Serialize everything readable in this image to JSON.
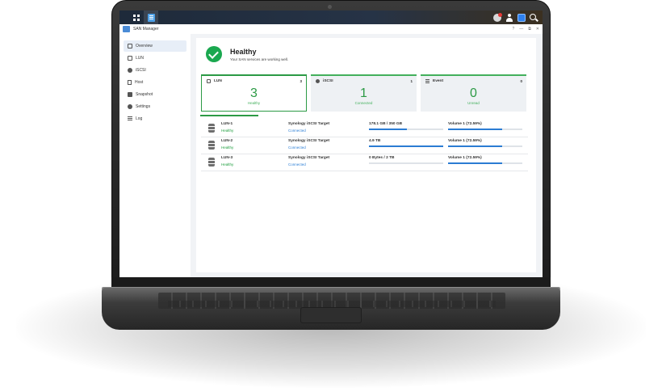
{
  "window": {
    "title": "SAN Manager",
    "controls": [
      "?",
      "—",
      "⧉",
      "✕"
    ]
  },
  "sidebar": {
    "items": [
      {
        "label": "Overview",
        "icon": "overview-icon",
        "active": true
      },
      {
        "label": "LUN",
        "icon": "lun-icon"
      },
      {
        "label": "iSCSI",
        "icon": "iscsi-icon"
      },
      {
        "label": "Host",
        "icon": "host-icon"
      },
      {
        "label": "Snapshot",
        "icon": "snapshot-icon"
      },
      {
        "label": "Settings",
        "icon": "settings-icon"
      },
      {
        "label": "Log",
        "icon": "log-icon"
      }
    ]
  },
  "health": {
    "title": "Healthy",
    "subtitle": "Your SAN services are working well."
  },
  "cards": [
    {
      "label": "LUN",
      "count": "3",
      "value": "3",
      "status": "Healthy"
    },
    {
      "label": "iSCSI",
      "count": "1",
      "value": "1",
      "status": "Connected"
    },
    {
      "label": "Event",
      "count": "0",
      "value": "0",
      "status": "Unread"
    }
  ],
  "luns": [
    {
      "name": "LUN-1",
      "status": "Healthy",
      "target": "Synology iSCSI Target",
      "target_status": "Connected",
      "capacity": "178.1 GB / 350 GB",
      "capacity_fraction": 0.509,
      "volume": "Volume 1 (72.59%)",
      "volume_fraction": 0.7259
    },
    {
      "name": "LUN-2",
      "status": "Healthy",
      "target": "Synology iSCSI Target",
      "target_status": "Connected",
      "capacity": "4.9 TB",
      "capacity_fraction": 1.0,
      "volume": "Volume 1 (72.59%)",
      "volume_fraction": 0.7259
    },
    {
      "name": "LUN-3",
      "status": "Healthy",
      "target": "Synology iSCSI Target",
      "target_status": "Connected",
      "capacity": "0 Bytes / 2 TB",
      "capacity_fraction": 0.0,
      "volume": "Volume 1 (72.59%)",
      "volume_fraction": 0.7259
    }
  ],
  "colors": {
    "healthy": "#1aa84f",
    "accent": "#2b7cd3",
    "card_border": "#43b05c"
  }
}
